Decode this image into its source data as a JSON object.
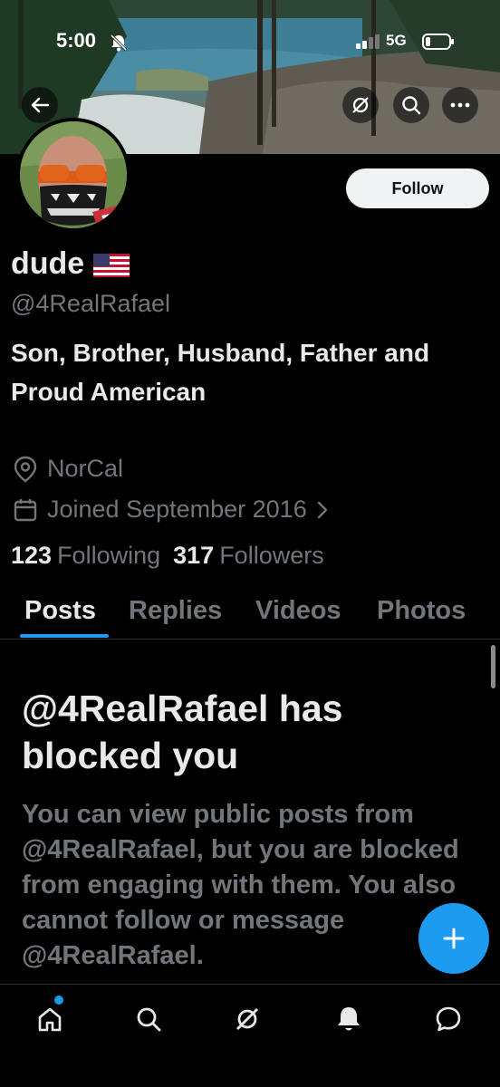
{
  "status_bar": {
    "time": "5:00",
    "network": "5G"
  },
  "profile": {
    "display_name": "dude",
    "handle": "@4RealRafael",
    "bio": "Son, Brother, Husband, Father and Proud American",
    "location": "NorCal",
    "joined": "Joined September 2016",
    "following_count": "123",
    "following_label": "Following",
    "followers_count": "317",
    "followers_label": "Followers",
    "follow_button_label": "Follow"
  },
  "tabs": [
    {
      "label": "Posts",
      "active": true
    },
    {
      "label": "Replies",
      "active": false
    },
    {
      "label": "Videos",
      "active": false
    },
    {
      "label": "Photos",
      "active": false
    }
  ],
  "blocked_notice": {
    "title": "@4RealRafael has blocked you",
    "body": "You can view public posts from @4RealRafael, but you are blocked from engaging with them. You also cannot follow or message @4RealRafael."
  },
  "bottom_nav": [
    "home-icon",
    "search-icon",
    "grok-icon",
    "notifications-icon",
    "messages-icon"
  ],
  "colors": {
    "accent": "#1d9bf0",
    "background": "#000000",
    "text_primary": "#e7e9ea",
    "text_secondary": "#71767b"
  }
}
